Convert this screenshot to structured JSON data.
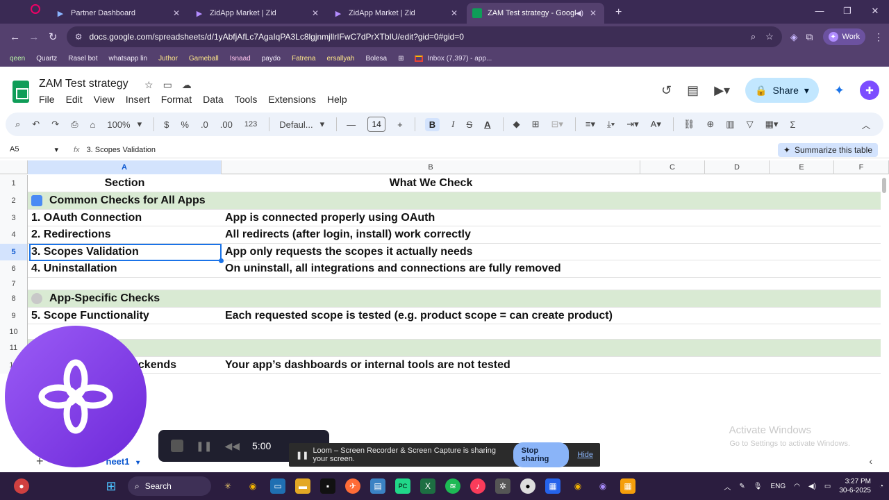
{
  "browser": {
    "tabs": [
      {
        "title": "Partner Dashboard",
        "active": false
      },
      {
        "title": "ZidApp Market | Zid",
        "active": false
      },
      {
        "title": "ZidApp Market | Zid",
        "active": false
      },
      {
        "title": "ZAM Test strategy - Google",
        "active": true
      }
    ],
    "url": "docs.google.com/spreadsheets/d/1yAbfjAfLc7AgaIqPA3Lc8lgjnmjllrIFwC7dPrXTbIU/edit?gid=0#gid=0",
    "profile_label": "Work",
    "bookmarks": [
      {
        "label": "qeen",
        "tone": "green"
      },
      {
        "label": "Quartz",
        "tone": "white"
      },
      {
        "label": "Rasel bot",
        "tone": "white"
      },
      {
        "label": "whatsapp lin",
        "tone": "white"
      },
      {
        "label": "Juthor",
        "tone": "yellow"
      },
      {
        "label": "Gameball",
        "tone": "yellow"
      },
      {
        "label": "Isnaad",
        "tone": "pink"
      },
      {
        "label": "paydo",
        "tone": "white"
      },
      {
        "label": "Fatrena",
        "tone": "yellow"
      },
      {
        "label": "ersallyah",
        "tone": "yellow"
      },
      {
        "label": "Bolesa",
        "tone": "white"
      }
    ],
    "gmail_bookmark": "Inbox (7,397) - app..."
  },
  "sheets": {
    "doc_title": "ZAM Test strategy",
    "menu": [
      "File",
      "Edit",
      "View",
      "Insert",
      "Format",
      "Data",
      "Tools",
      "Extensions",
      "Help"
    ],
    "share_label": "Share",
    "toolbar": {
      "zoom": "100%",
      "currency": "$",
      "percent": "%",
      "dec_decrease": ".0",
      "dec_increase": ".00",
      "number_format": "123",
      "font": "Defaul...",
      "font_size": "14"
    },
    "name_box": "A5",
    "formula": "3. Scopes Validation",
    "summarize_label": "Summarize this table",
    "columns": [
      "A",
      "B",
      "C",
      "D",
      "E",
      "F"
    ],
    "rows": [
      {
        "n": "1",
        "a": "Section",
        "b": "What We Check",
        "style": "header"
      },
      {
        "n": "2",
        "a": "Common Checks for All Apps",
        "b": "",
        "style": "section",
        "icon": "blue"
      },
      {
        "n": "3",
        "a": "1. OAuth Connection",
        "b": "App is connected properly using OAuth",
        "style": "normal"
      },
      {
        "n": "4",
        "a": "2. Redirections",
        "b": "All redirects (after login, install) work correctly",
        "style": "normal"
      },
      {
        "n": "5",
        "a": "3. Scopes Validation",
        "b": "App only requests the scopes it actually needs",
        "style": "normal"
      },
      {
        "n": "6",
        "a": "4. Uninstallation",
        "b": "On uninstall, all integrations and connections are fully removed",
        "style": "normal"
      },
      {
        "n": "7",
        "a": "",
        "b": "",
        "style": "normal"
      },
      {
        "n": "8",
        "a": "App-Specific Checks",
        "b": "",
        "style": "section",
        "icon": "grey"
      },
      {
        "n": "9",
        "a": "5. Scope Functionality",
        "b": "Each requested scope is tested (e.g. product scope = can create product)",
        "style": "normal"
      },
      {
        "n": "10",
        "a": "",
        "b": "",
        "style": "normal"
      },
      {
        "n": "11",
        "a": "",
        "b": "",
        "style": "section"
      },
      {
        "n": "12",
        "a": "ackends",
        "b": "Your app’s dashboards or internal tools are not tested",
        "style": "normal"
      }
    ],
    "sheet_tab": "heet1"
  },
  "loom": {
    "timer": "5:00",
    "share_message": "Loom – Screen Recorder & Screen Capture is sharing your screen.",
    "stop_sharing": "Stop sharing",
    "hide": "Hide"
  },
  "windows": {
    "activate_title": "Activate Windows",
    "activate_sub": "Go to Settings to activate Windows.",
    "search_label": "Search",
    "lang": "ENG",
    "time": "3:27 PM",
    "date": "30-6-2025"
  }
}
